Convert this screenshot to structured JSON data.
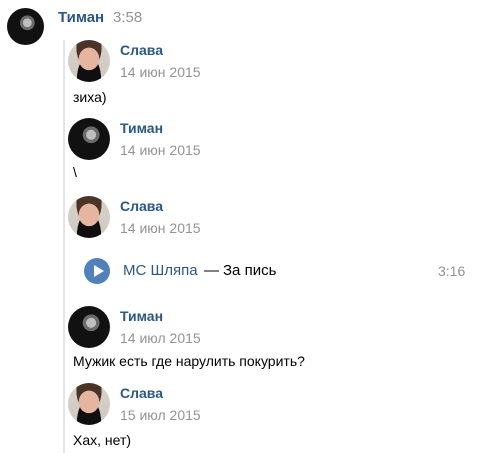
{
  "header": {
    "author_name": "Тиман",
    "time": "3:58"
  },
  "messages": [
    {
      "author": "Слава",
      "date": "14 июн 2015",
      "text": "зиха)"
    },
    {
      "author": "Тиман",
      "date": "14 июн 2015",
      "text": "\\"
    },
    {
      "author": "Слава",
      "date": "14 июн 2015",
      "audio": {
        "artist": "МС Шляпа",
        "separator": "—",
        "title": "За пись",
        "duration": "3:16"
      }
    },
    {
      "author": "Тиман",
      "date": "14 июл 2015",
      "text": "Мужик есть где нарулить покурить?"
    },
    {
      "author": "Слава",
      "date": "15 июл 2015",
      "text": "Хах, нет)"
    }
  ],
  "colors": {
    "link_blue": "#2a5885",
    "gray_text": "#939393",
    "accent_blue": "#5181b8",
    "forward_line": "#e1e5eb"
  },
  "icons": {
    "play": "play-icon"
  }
}
